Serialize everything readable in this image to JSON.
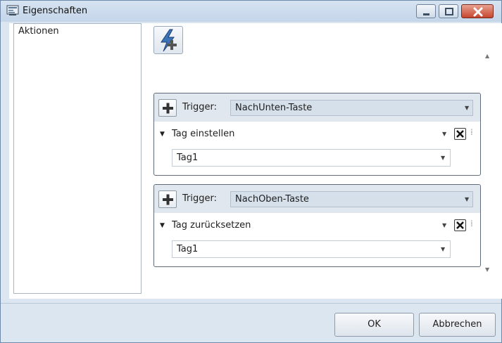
{
  "window": {
    "title": "Eigenschaften",
    "icon": "properties-window-icon",
    "controls": [
      "minimize-icon",
      "maximize-icon",
      "close-icon"
    ]
  },
  "sidebar": {
    "label": "Aktionen"
  },
  "toolbar": {
    "add_action_icon": "lightning-plus-icon"
  },
  "groups": [
    {
      "trigger_label": "Trigger:",
      "trigger_value": "NachUnten-Taste",
      "action": "Tag einstellen",
      "tag": "Tag1"
    },
    {
      "trigger_label": "Trigger:",
      "trigger_value": "NachOben-Taste",
      "action": "Tag zurücksetzen",
      "tag": "Tag1"
    }
  ],
  "footer": {
    "ok_label": "OK",
    "cancel_label": "Abbrechen"
  },
  "colors": {
    "titlebar": "#c4d6ea",
    "close_button": "#c6452e",
    "group_header": "#e1e7ee"
  }
}
